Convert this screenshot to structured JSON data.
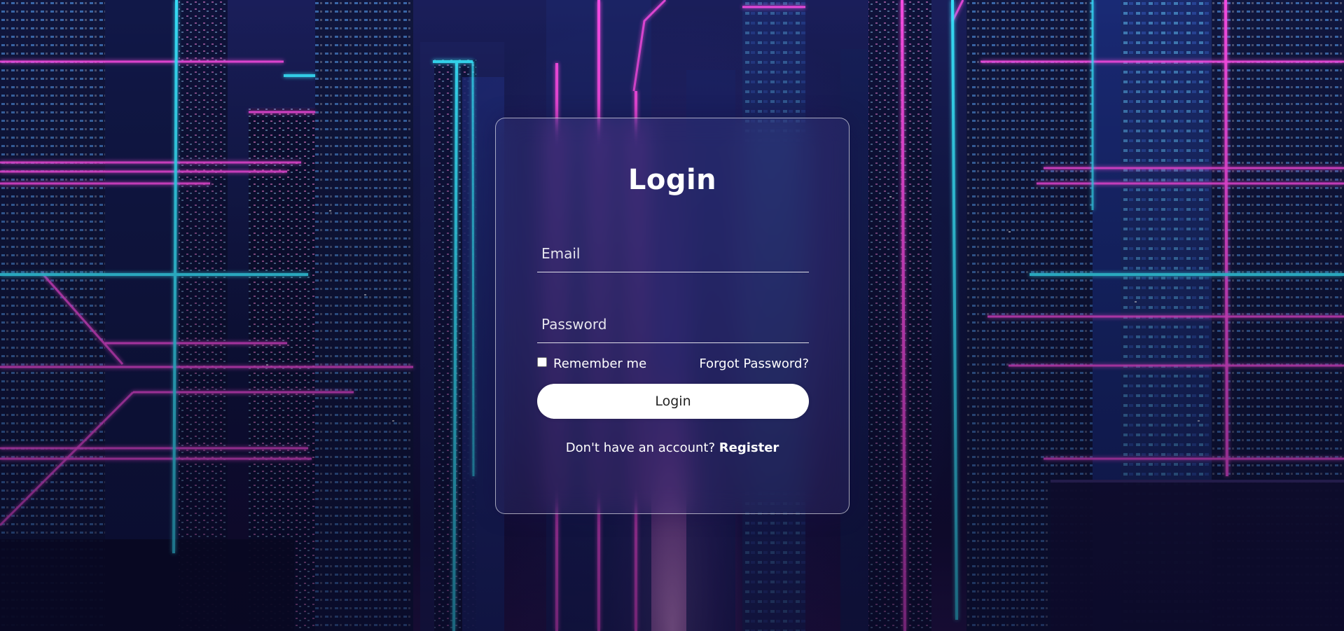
{
  "login_form": {
    "title": "Login",
    "email_placeholder": "Email",
    "password_placeholder": "Password",
    "remember_label": "Remember me",
    "remember_checked": false,
    "forgot_label": "Forgot Password?",
    "submit_label": "Login",
    "no_account_text": "Don't have an account?",
    "register_label": "Register"
  },
  "theme": {
    "text_color": "#ffffff",
    "button_bg": "#ffffff",
    "button_text": "#222222",
    "neon_cyan": "#39e6ff",
    "neon_magenta": "#ff4de8",
    "sky_dark": "#141a4e"
  }
}
